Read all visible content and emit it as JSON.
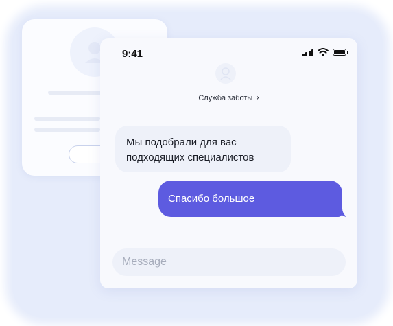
{
  "status_bar": {
    "time": "9:41"
  },
  "chat": {
    "contact_name": "Служба заботы",
    "messages": [
      {
        "from": "support",
        "lines": [
          "Мы подобрали для вас",
          "подходящих специалистов"
        ]
      },
      {
        "from": "user",
        "text": "Спасибо большое"
      }
    ]
  },
  "composer": {
    "placeholder": "Message"
  },
  "colors": {
    "accent": "#5d5be0",
    "incoming_bubble": "#eef1f9",
    "background_glow": "#e6ecfb"
  },
  "icons": [
    "signal-icon",
    "wifi-icon",
    "battery-icon",
    "chevron-right-icon",
    "support-avatar-icon"
  ]
}
